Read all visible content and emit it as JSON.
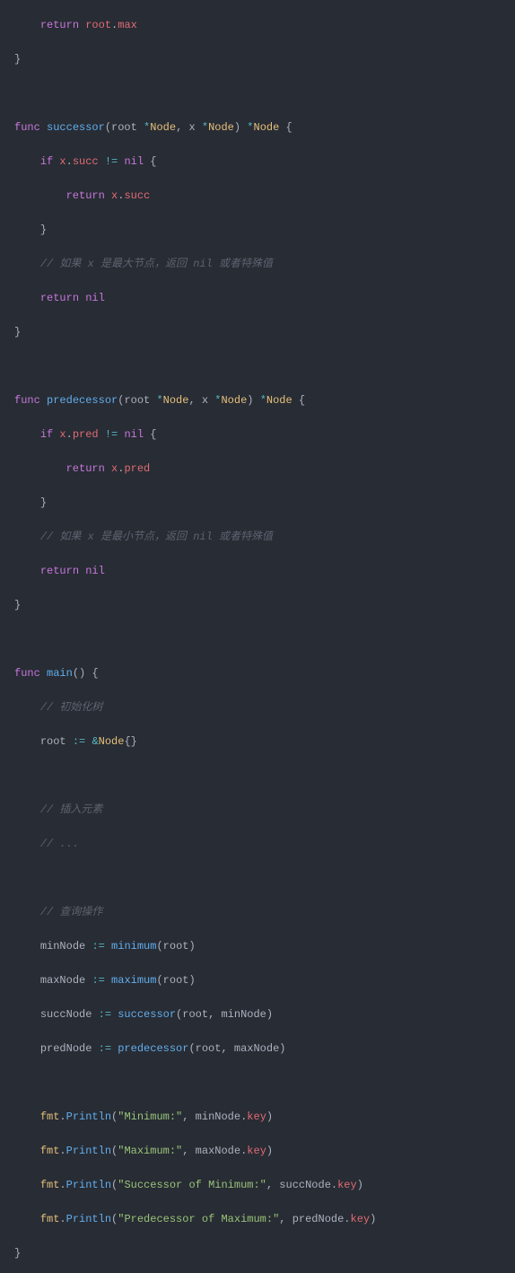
{
  "code": {
    "l0_ret": "return",
    "l0_root": "root",
    "l0_max": "max",
    "l1_brace": "}",
    "l3_func": "func",
    "l3_name": "successor",
    "l3_p1": "root",
    "l3_t1s": "*",
    "l3_t1": "Node",
    "l3_p2": "x",
    "l3_t2s": "*",
    "l3_t2": "Node",
    "l3_rts": "*",
    "l3_rt": "Node",
    "l4_if": "if",
    "l4_x": "x",
    "l4_succ": "succ",
    "l4_ne": "!=",
    "l4_nil": "nil",
    "l5_ret": "return",
    "l5_x": "x",
    "l5_succ": "succ",
    "l6_brace": "}",
    "l7_comment": "// 如果 x 是最大节点，返回 nil 或者特殊值",
    "l8_ret": "return",
    "l8_nil": "nil",
    "l9_brace": "}",
    "l11_func": "func",
    "l11_name": "predecessor",
    "l11_p1": "root",
    "l11_t1s": "*",
    "l11_t1": "Node",
    "l11_p2": "x",
    "l11_t2s": "*",
    "l11_t2": "Node",
    "l11_rts": "*",
    "l11_rt": "Node",
    "l12_if": "if",
    "l12_x": "x",
    "l12_pred": "pred",
    "l12_ne": "!=",
    "l12_nil": "nil",
    "l13_ret": "return",
    "l13_x": "x",
    "l13_pred": "pred",
    "l14_brace": "}",
    "l15_comment": "// 如果 x 是最小节点，返回 nil 或者特殊值",
    "l16_ret": "return",
    "l16_nil": "nil",
    "l17_brace": "}",
    "l19_func": "func",
    "l19_name": "main",
    "l20_comment": "// 初始化树",
    "l21_root": "root",
    "l21_assign": ":=",
    "l21_amp": "&",
    "l21_node": "Node",
    "l23_comment": "// 插入元素",
    "l24_comment": "// ...",
    "l26_comment": "// 查询操作",
    "l27_v": "minNode",
    "l27_assign": ":=",
    "l27_fn": "minimum",
    "l27_arg": "root",
    "l28_v": "maxNode",
    "l28_assign": ":=",
    "l28_fn": "maximum",
    "l28_arg": "root",
    "l29_v": "succNode",
    "l29_assign": ":=",
    "l29_fn": "successor",
    "l29_a1": "root",
    "l29_a2": "minNode",
    "l30_v": "predNode",
    "l30_assign": ":=",
    "l30_fn": "predecessor",
    "l30_a1": "root",
    "l30_a2": "maxNode",
    "l32_pkg": "fmt",
    "l32_fn": "Println",
    "l32_str": "\"Minimum:\"",
    "l32_v": "minNode",
    "l32_prop": "key",
    "l33_pkg": "fmt",
    "l33_fn": "Println",
    "l33_str": "\"Maximum:\"",
    "l33_v": "maxNode",
    "l33_prop": "key",
    "l34_pkg": "fmt",
    "l34_fn": "Println",
    "l34_str": "\"Successor of Minimum:\"",
    "l34_v": "succNode",
    "l34_prop": "key",
    "l35_pkg": "fmt",
    "l35_fn": "Println",
    "l35_str": "\"Predecessor of Maximum:\"",
    "l35_v": "predNode",
    "l35_prop": "key",
    "l36_brace": "}"
  }
}
